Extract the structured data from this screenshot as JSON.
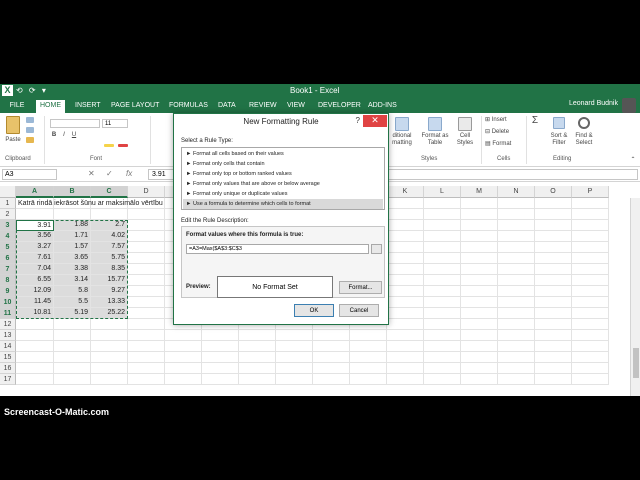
{
  "window": {
    "title": "Book1 - Excel",
    "qat": "⟲ ⟳ ▾"
  },
  "ribbon_tabs": {
    "file": "FILE",
    "tabs": [
      "HOME",
      "INSERT",
      "PAGE LAYOUT",
      "FORMULAS",
      "DATA",
      "REVIEW",
      "VIEW",
      "DEVELOPER",
      "ADD-INS"
    ],
    "user": "Leonard Budnik"
  },
  "ribbon": {
    "clipboard": {
      "paste": "Paste",
      "label": "Clipboard"
    },
    "font": {
      "size": "11",
      "label": "Font"
    },
    "styles": {
      "conditional": "...ditional\nmatting",
      "format_as_table": "Format as Table",
      "cell_styles": "Cell Styles",
      "label": "Styles"
    },
    "cells": {
      "insert": "Insert",
      "delete": "Delete",
      "format": "Format",
      "label": "Cells"
    },
    "editing": {
      "sort": "Sort & Filter",
      "find": "Find & Select",
      "label": "Editing"
    }
  },
  "formula_bar": {
    "name_box": "A3",
    "formula": "3.91",
    "fx": "fx"
  },
  "grid": {
    "columns": [
      "A",
      "B",
      "C",
      "D",
      "E",
      "F",
      "G",
      "H",
      "I",
      "J",
      "K",
      "L",
      "M",
      "N",
      "O",
      "P"
    ],
    "rows": [
      "1",
      "2",
      "3",
      "4",
      "5",
      "6",
      "7",
      "8",
      "9",
      "10",
      "11",
      "12",
      "13",
      "14",
      "15",
      "16",
      "17"
    ],
    "a1_text": "Katrā rindā iekrāsot šūnu ar maksimālo vērtību",
    "data": [
      [
        "3.91",
        "1.88",
        "2.7"
      ],
      [
        "3.56",
        "1.71",
        "4.02"
      ],
      [
        "3.27",
        "1.57",
        "7.57"
      ],
      [
        "7.61",
        "3.65",
        "5.75"
      ],
      [
        "7.04",
        "3.38",
        "8.35"
      ],
      [
        "6.55",
        "3.14",
        "15.77"
      ],
      [
        "12.09",
        "5.8",
        "9.27"
      ],
      [
        "11.45",
        "5.5",
        "13.33"
      ],
      [
        "10.81",
        "5.19",
        "25.22"
      ]
    ]
  },
  "dialog": {
    "title": "New Formatting Rule",
    "help": "?",
    "close": "✕",
    "select_label": "Select a Rule Type:",
    "rule_types": [
      "► Format all cells based on their values",
      "► Format only cells that contain",
      "► Format only top or bottom ranked values",
      "► Format only values that are above or below average",
      "► Format only unique or duplicate values",
      "► Use a formula to determine which cells to format"
    ],
    "edit_label": "Edit the Rule Description:",
    "formula_label": "Format values where this formula is true:",
    "formula_value": "=A3=Max($A$3:$C$3",
    "preview_label": "Preview:",
    "preview_text": "No Format Set",
    "format_button": "Format...",
    "ok": "OK",
    "cancel": "Cancel"
  },
  "watermark": "Screencast-O-Matic.com"
}
